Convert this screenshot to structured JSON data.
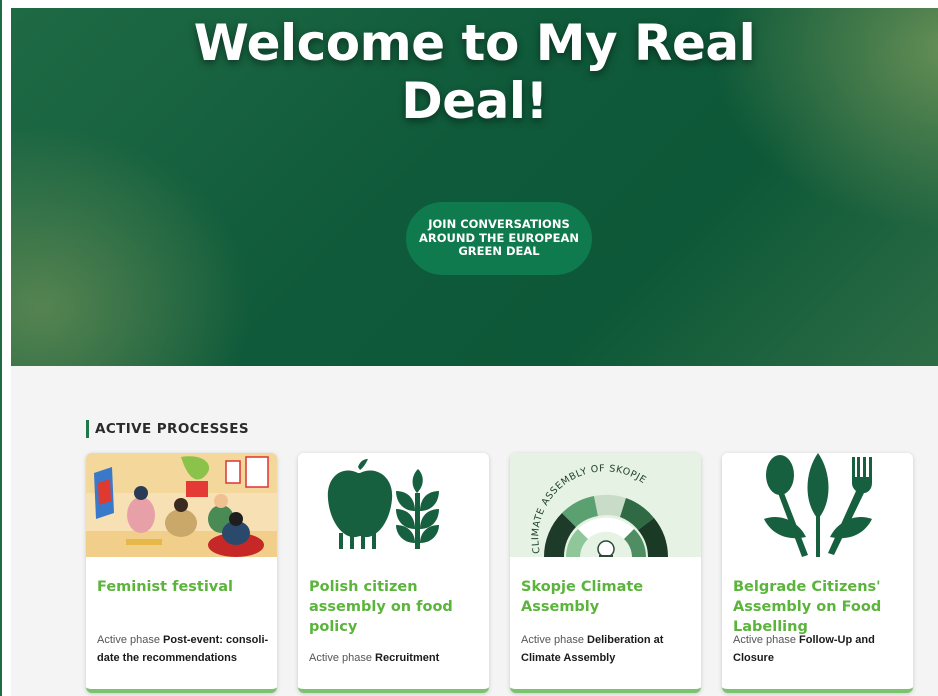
{
  "hero": {
    "title_line1": "Welcome to My Real",
    "title_line2": "Deal!",
    "cta_label": "JOIN CONVERSATIONS AROUND THE EUROPEAN GREEN DEAL"
  },
  "section": {
    "title": "ACTIVE PROCESSES"
  },
  "cards": [
    {
      "title": "Feminist festival",
      "phase_label": "Active phase",
      "phase_value": "Post-event: consoli-date the recommendations",
      "image": "feminist-festival-illustration"
    },
    {
      "title": "Polish citizen assembly on food policy",
      "phase_label": "Active phase",
      "phase_value": "Recruitment",
      "image": "apple-and-wheat-icon"
    },
    {
      "title": "Skopje Climate Assembly",
      "phase_label": "Active phase",
      "phase_value": "Deliberation at Climate Assembly",
      "image": "climate-assembly-of-skopje-logo",
      "logo_text": "CLIMATE ASSEMBLY OF SKOPJE"
    },
    {
      "title": "Belgrade Citizens' Assembly on Food Labelling",
      "phase_label": "Active phase",
      "phase_value": "Follow-Up and Closure",
      "image": "spoon-fork-leaves-icon"
    }
  ],
  "colors": {
    "hero_green": "#0f5a3a",
    "cta_green": "#0e7a4d",
    "card_title_green": "#5bb43c",
    "icon_green": "#17603f"
  }
}
